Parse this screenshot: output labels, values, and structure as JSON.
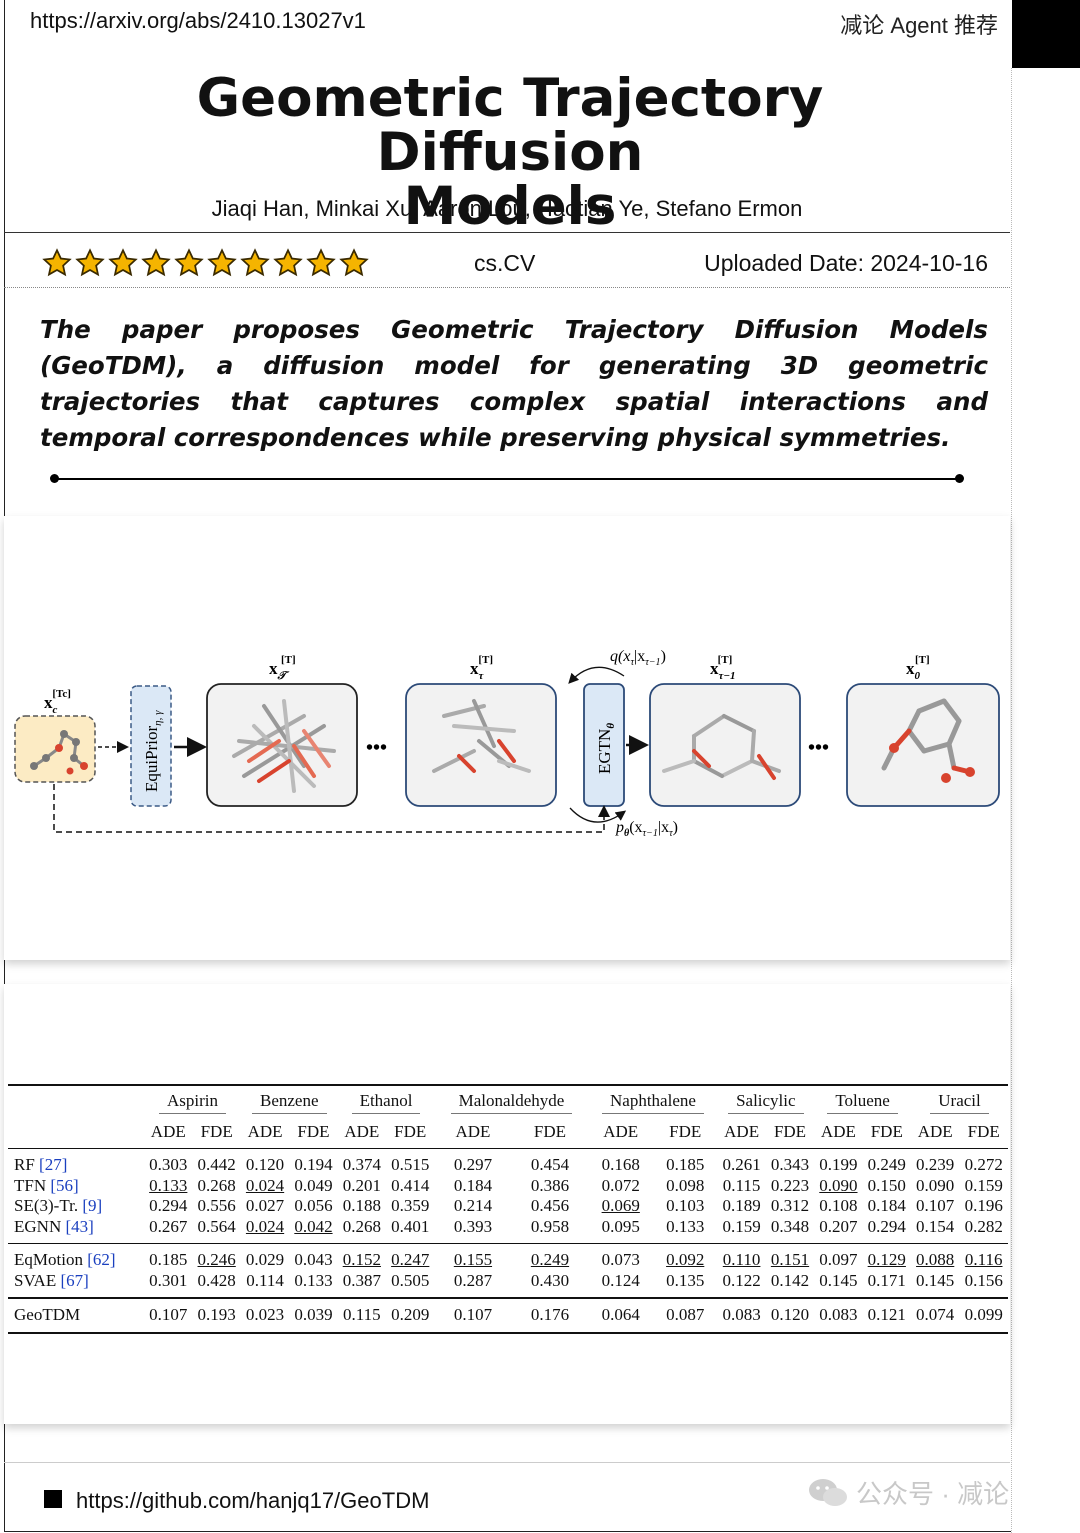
{
  "header": {
    "url": "https://arxiv.org/abs/2410.13027v1",
    "tagline": "减论 Agent 推荐"
  },
  "paper": {
    "title_line1": "Geometric Trajectory Diffusion",
    "title_line2": "Models",
    "authors": "Jiaqi Han, Minkai Xu, Aaron Lou, Haotian Ye, Stefano Ermon",
    "rating_stars": 10,
    "category": "cs.CV",
    "uploaded": "Uploaded Date: 2024-10-16",
    "summary": "The paper proposes Geometric Trajectory Diffusion Models (GeoTDM), a diffusion model for generating 3D geometric trajectories that captures complex spatial interactions and temporal correspondences while preserving physical symmetries."
  },
  "figure": {
    "cond_label": "x",
    "cond_sub": "c",
    "cond_sup": "[Tc]",
    "prior_label": "EquiPrior",
    "prior_sub": "η, γ",
    "egtn_label": "EGTN",
    "egtn_sub": "θ",
    "box1_label": "x",
    "box1_sub": "𝒯",
    "box2_label": "x",
    "box2_sub": "τ",
    "box3_label": "x",
    "box3_sub": "τ−1",
    "box4_label": "x",
    "box4_sub": "0",
    "sup_T": "[T]",
    "forward_label": "q(x",
    "forward_rest": "|x",
    "reverse_label": "p",
    "ellipsis": "•••"
  },
  "table": {
    "datasets": [
      "Aspirin",
      "Benzene",
      "Ethanol",
      "Malonaldehyde",
      "Naphthalene",
      "Salicylic",
      "Toluene",
      "Uracil"
    ],
    "metrics": [
      "ADE",
      "FDE"
    ],
    "groups": [
      [
        {
          "method": "RF",
          "ref": "[27]",
          "values": [
            "0.303",
            "0.442",
            "0.120",
            "0.194",
            "0.374",
            "0.515",
            "0.297",
            "0.454",
            "0.168",
            "0.185",
            "0.261",
            "0.343",
            "0.199",
            "0.249",
            "0.239",
            "0.272"
          ],
          "underline": []
        },
        {
          "method": "TFN",
          "ref": "[56]",
          "values": [
            "0.133",
            "0.268",
            "0.024",
            "0.049",
            "0.201",
            "0.414",
            "0.184",
            "0.386",
            "0.072",
            "0.098",
            "0.115",
            "0.223",
            "0.090",
            "0.150",
            "0.090",
            "0.159"
          ],
          "underline": [
            0,
            2,
            12
          ]
        },
        {
          "method": "SE(3)-Tr.",
          "ref": "[9]",
          "values": [
            "0.294",
            "0.556",
            "0.027",
            "0.056",
            "0.188",
            "0.359",
            "0.214",
            "0.456",
            "0.069",
            "0.103",
            "0.189",
            "0.312",
            "0.108",
            "0.184",
            "0.107",
            "0.196"
          ],
          "underline": [
            8
          ]
        },
        {
          "method": "EGNN",
          "ref": "[43]",
          "values": [
            "0.267",
            "0.564",
            "0.024",
            "0.042",
            "0.268",
            "0.401",
            "0.393",
            "0.958",
            "0.095",
            "0.133",
            "0.159",
            "0.348",
            "0.207",
            "0.294",
            "0.154",
            "0.282"
          ],
          "underline": [
            2,
            3
          ]
        }
      ],
      [
        {
          "method": "EqMotion",
          "ref": "[62]",
          "values": [
            "0.185",
            "0.246",
            "0.029",
            "0.043",
            "0.152",
            "0.247",
            "0.155",
            "0.249",
            "0.073",
            "0.092",
            "0.110",
            "0.151",
            "0.097",
            "0.129",
            "0.088",
            "0.116"
          ],
          "underline": [
            1,
            4,
            5,
            6,
            7,
            9,
            10,
            11,
            13,
            14,
            15
          ]
        },
        {
          "method": "SVAE",
          "ref": "[67]",
          "values": [
            "0.301",
            "0.428",
            "0.114",
            "0.133",
            "0.387",
            "0.505",
            "0.287",
            "0.430",
            "0.124",
            "0.135",
            "0.122",
            "0.142",
            "0.145",
            "0.171",
            "0.145",
            "0.156"
          ],
          "underline": []
        }
      ],
      [
        {
          "method": "GeoTDM",
          "ref": "",
          "values": [
            "0.107",
            "0.193",
            "0.023",
            "0.039",
            "0.115",
            "0.209",
            "0.107",
            "0.176",
            "0.064",
            "0.087",
            "0.083",
            "0.120",
            "0.083",
            "0.121",
            "0.074",
            "0.099"
          ],
          "underline": [],
          "bold": true
        }
      ]
    ]
  },
  "footer": {
    "repo_url": "https://github.com/hanjq17/GeoTDM",
    "watermark": "公众号 · 减论"
  },
  "colors": {
    "star": "#f5b400",
    "accent_red": "#d8432e",
    "box_blue": "#dbe8f6",
    "cond_fill": "#fcebc4"
  }
}
